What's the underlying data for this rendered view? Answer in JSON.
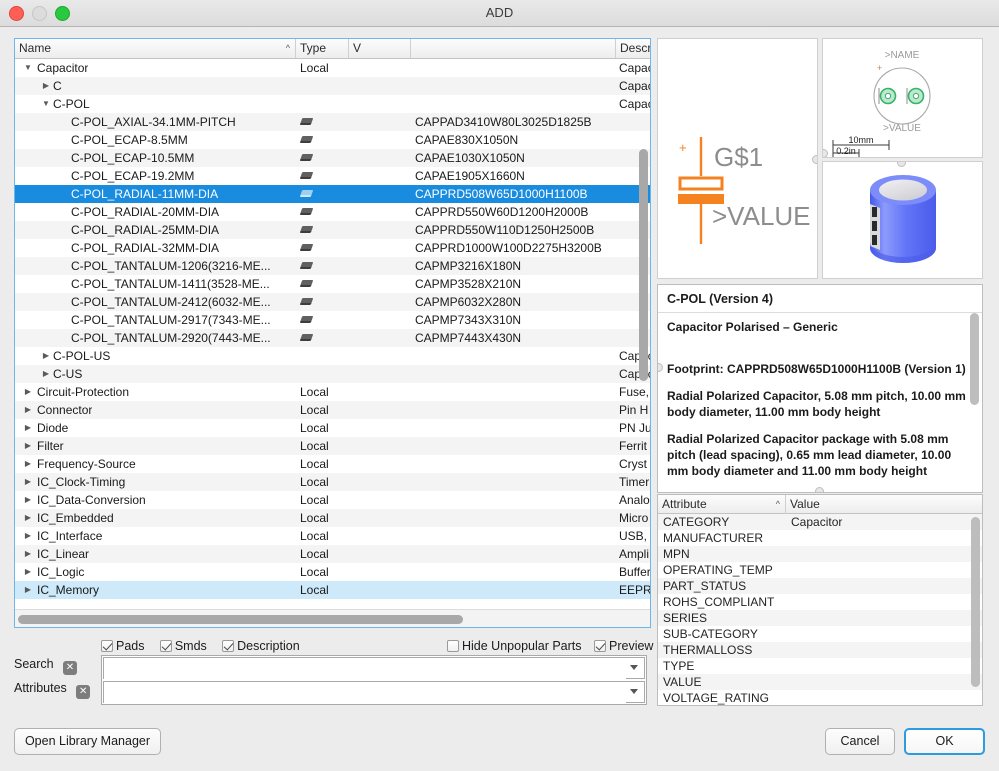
{
  "window": {
    "title": "ADD",
    "traffic_lights": [
      "close-button",
      "minimize-button",
      "maximize-button"
    ]
  },
  "tree": {
    "columns": [
      {
        "label": "Name",
        "sort_caret": "^"
      },
      {
        "label": "Type"
      },
      {
        "label": "V"
      },
      {
        "label": ""
      },
      {
        "label": "Descript"
      }
    ],
    "rows": [
      {
        "indent": 0,
        "twisty": "open",
        "name": "Capacitor",
        "type": "Local",
        "package": "",
        "desc": "Capac"
      },
      {
        "indent": 1,
        "twisty": "closed",
        "name": "C",
        "type": "",
        "package": "",
        "desc": "Capac"
      },
      {
        "indent": 1,
        "twisty": "open",
        "name": "C-POL",
        "type": "",
        "package": "",
        "desc": "Capac"
      },
      {
        "indent": 2,
        "twisty": "none",
        "name": "C-POL_AXIAL-34.1MM-PITCH",
        "type": "",
        "icon": "footprint-icon",
        "package": "CAPPAD3410W80L3025D1825B",
        "desc": ""
      },
      {
        "indent": 2,
        "twisty": "none",
        "name": "C-POL_ECAP-8.5MM",
        "type": "",
        "icon": "footprint-icon",
        "package": "CAPAE830X1050N",
        "desc": ""
      },
      {
        "indent": 2,
        "twisty": "none",
        "name": "C-POL_ECAP-10.5MM",
        "type": "",
        "icon": "footprint-icon",
        "package": "CAPAE1030X1050N",
        "desc": ""
      },
      {
        "indent": 2,
        "twisty": "none",
        "name": "C-POL_ECAP-19.2MM",
        "type": "",
        "icon": "footprint-icon",
        "package": "CAPAE1905X1660N",
        "desc": ""
      },
      {
        "indent": 2,
        "twisty": "none",
        "name": "C-POL_RADIAL-11MM-DIA",
        "type": "",
        "icon": "footprint-icon",
        "package": "CAPPRD508W65D1000H1100B",
        "desc": "",
        "selected": true
      },
      {
        "indent": 2,
        "twisty": "none",
        "name": "C-POL_RADIAL-20MM-DIA",
        "type": "",
        "icon": "footprint-icon",
        "package": "CAPPRD550W60D1200H2000B",
        "desc": ""
      },
      {
        "indent": 2,
        "twisty": "none",
        "name": "C-POL_RADIAL-25MM-DIA",
        "type": "",
        "icon": "footprint-icon",
        "package": "CAPPRD550W110D1250H2500B",
        "desc": ""
      },
      {
        "indent": 2,
        "twisty": "none",
        "name": "C-POL_RADIAL-32MM-DIA",
        "type": "",
        "icon": "footprint-icon",
        "package": "CAPPRD1000W100D2275H3200B",
        "desc": ""
      },
      {
        "indent": 2,
        "twisty": "none",
        "name": "C-POL_TANTALUM-1206(3216-ME...",
        "type": "",
        "icon": "footprint-icon",
        "package": "CAPMP3216X180N",
        "desc": ""
      },
      {
        "indent": 2,
        "twisty": "none",
        "name": "C-POL_TANTALUM-1411(3528-ME...",
        "type": "",
        "icon": "footprint-icon",
        "package": "CAPMP3528X210N",
        "desc": ""
      },
      {
        "indent": 2,
        "twisty": "none",
        "name": "C-POL_TANTALUM-2412(6032-ME...",
        "type": "",
        "icon": "footprint-icon",
        "package": "CAPMP6032X280N",
        "desc": ""
      },
      {
        "indent": 2,
        "twisty": "none",
        "name": "C-POL_TANTALUM-2917(7343-ME...",
        "type": "",
        "icon": "footprint-icon",
        "package": "CAPMP7343X310N",
        "desc": ""
      },
      {
        "indent": 2,
        "twisty": "none",
        "name": "C-POL_TANTALUM-2920(7443-ME...",
        "type": "",
        "icon": "footprint-icon",
        "package": "CAPMP7443X430N",
        "desc": ""
      },
      {
        "indent": 1,
        "twisty": "closed",
        "name": "C-POL-US",
        "type": "",
        "package": "",
        "desc": "Capac"
      },
      {
        "indent": 1,
        "twisty": "closed",
        "name": "C-US",
        "type": "",
        "package": "",
        "desc": "Capac"
      },
      {
        "indent": 0,
        "twisty": "closed",
        "name": "Circuit-Protection",
        "type": "Local",
        "package": "",
        "desc": "Fuse,"
      },
      {
        "indent": 0,
        "twisty": "closed",
        "name": "Connector",
        "type": "Local",
        "package": "",
        "desc": "Pin H"
      },
      {
        "indent": 0,
        "twisty": "closed",
        "name": "Diode",
        "type": "Local",
        "package": "",
        "desc": "PN Ju"
      },
      {
        "indent": 0,
        "twisty": "closed",
        "name": "Filter",
        "type": "Local",
        "package": "",
        "desc": "Ferrit"
      },
      {
        "indent": 0,
        "twisty": "closed",
        "name": "Frequency-Source",
        "type": "Local",
        "package": "",
        "desc": "Cryst"
      },
      {
        "indent": 0,
        "twisty": "closed",
        "name": "IC_Clock-Timing",
        "type": "Local",
        "package": "",
        "desc": "Timer"
      },
      {
        "indent": 0,
        "twisty": "closed",
        "name": "IC_Data-Conversion",
        "type": "Local",
        "package": "",
        "desc": "Analo"
      },
      {
        "indent": 0,
        "twisty": "closed",
        "name": "IC_Embedded",
        "type": "Local",
        "package": "",
        "desc": "Micro"
      },
      {
        "indent": 0,
        "twisty": "closed",
        "name": "IC_Interface",
        "type": "Local",
        "package": "",
        "desc": "USB, "
      },
      {
        "indent": 0,
        "twisty": "closed",
        "name": "IC_Linear",
        "type": "Local",
        "package": "",
        "desc": "Ampli"
      },
      {
        "indent": 0,
        "twisty": "closed",
        "name": "IC_Logic",
        "type": "Local",
        "package": "",
        "desc": "Buffer"
      },
      {
        "indent": 0,
        "twisty": "closed",
        "name": "IC_Memory",
        "type": "Local",
        "package": "",
        "desc": "EEPRO",
        "hover": true
      }
    ]
  },
  "symbol_preview": {
    "name_label": "G$1",
    "value_label": ">VALUE",
    "plus_label": "+",
    "accent_color": "#f58220"
  },
  "footprint_preview": {
    "name_label": ">NAME",
    "value_label": ">VALUE",
    "plus_label": "+",
    "scale_mm": "10mm",
    "scale_in": "0.2in",
    "pad_color": "#35b36a"
  },
  "render_preview": {
    "body_color": "#5b6ef5",
    "top_color": "#e0e0e2"
  },
  "description": {
    "title": "C-POL (Version 4)",
    "paragraphs": [
      "Capacitor Polarised – Generic",
      "Footprint: CAPPRD508W65D1000H1100B (Version 1)",
      "Radial Polarized Capacitor, 5.08 mm pitch, 10.00 mm body diameter, 11.00 mm body height",
      "Radial Polarized Capacitor package with 5.08 mm pitch (lead spacing), 0.65 mm lead diameter, 10.00 mm body diameter and 11.00 mm body height"
    ]
  },
  "attributes": {
    "columns": [
      {
        "label": "Attribute",
        "sort_caret": "^"
      },
      {
        "label": "Value"
      }
    ],
    "rows": [
      {
        "key": "CATEGORY",
        "value": "Capacitor"
      },
      {
        "key": "MANUFACTURER",
        "value": ""
      },
      {
        "key": "MPN",
        "value": ""
      },
      {
        "key": "OPERATING_TEMP",
        "value": ""
      },
      {
        "key": "PART_STATUS",
        "value": ""
      },
      {
        "key": "ROHS_COMPLIANT",
        "value": ""
      },
      {
        "key": "SERIES",
        "value": ""
      },
      {
        "key": "SUB-CATEGORY",
        "value": ""
      },
      {
        "key": "THERMALLOSS",
        "value": ""
      },
      {
        "key": "TYPE",
        "value": ""
      },
      {
        "key": "VALUE",
        "value": ""
      },
      {
        "key": "VOLTAGE_RATING",
        "value": ""
      }
    ]
  },
  "filters": {
    "pads": {
      "label": "Pads",
      "checked": true
    },
    "smds": {
      "label": "Smds",
      "checked": true
    },
    "description": {
      "label": "Description",
      "checked": true
    },
    "hide_unpopular": {
      "label": "Hide Unpopular Parts",
      "checked": false
    },
    "preview": {
      "label": "Preview",
      "checked": true
    }
  },
  "search": {
    "label": "Search",
    "value": "",
    "clear_glyph": "✕"
  },
  "attributes_filter": {
    "label": "Attributes",
    "value": "",
    "clear_glyph": "✕"
  },
  "buttons": {
    "open_library_manager": "Open Library Manager",
    "cancel": "Cancel",
    "ok": "OK"
  }
}
